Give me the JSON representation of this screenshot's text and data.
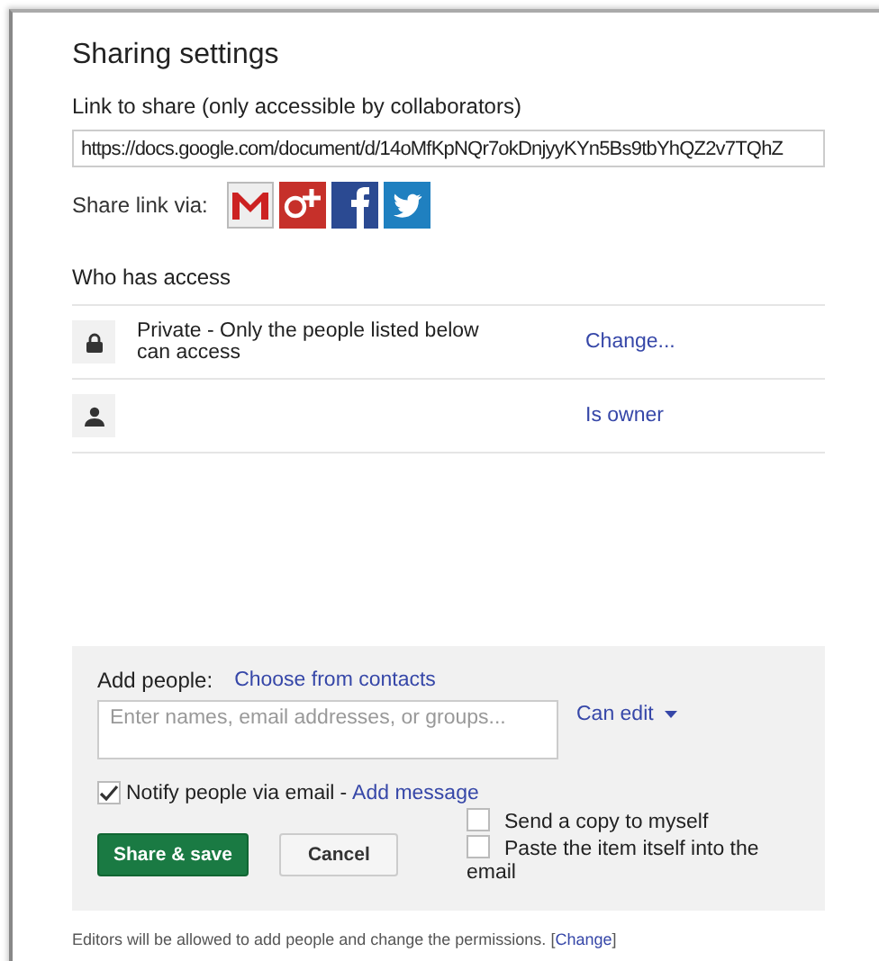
{
  "dialog": {
    "title": "Sharing settings"
  },
  "link": {
    "label": "Link to share (only accessible by collaborators)",
    "value": "https://docs.google.com/document/d/14oMfKpNQr7okDnjyyKYn5Bs9tbYhQZ2v7TQhZ"
  },
  "share_via": {
    "label": "Share link via:",
    "services": [
      {
        "kind": "mail"
      },
      {
        "kind": "plus"
      },
      {
        "kind": "f"
      },
      {
        "kind": "bird"
      }
    ]
  },
  "access": {
    "heading": "Who has access",
    "rows": [
      {
        "kind": "lock",
        "text": "Private - Only the people listed below can access",
        "action": "Change..."
      },
      {
        "kind": "person",
        "action": "Is owner"
      }
    ]
  },
  "add_people": {
    "label": "Add people:",
    "contacts_link": "Choose from contacts",
    "placeholder": "Enter names, email addresses, or groups...",
    "permission": "Can edit",
    "notify": {
      "label": "Notify people via email",
      "separator": "-",
      "link": "Add message",
      "checked": true
    },
    "options": [
      {
        "label": "Send a copy to myself",
        "checked": false
      },
      {
        "label": "Paste the item itself into the email",
        "checked": false
      }
    ],
    "buttons": [
      {
        "label": "Share & save",
        "kind": "primary"
      },
      {
        "label": "Cancel",
        "kind": "secondary"
      }
    ]
  },
  "footer": {
    "text": "Editors will be allowed to add people and change the permissions.",
    "open": "[",
    "link": "Change",
    "close": "]"
  }
}
